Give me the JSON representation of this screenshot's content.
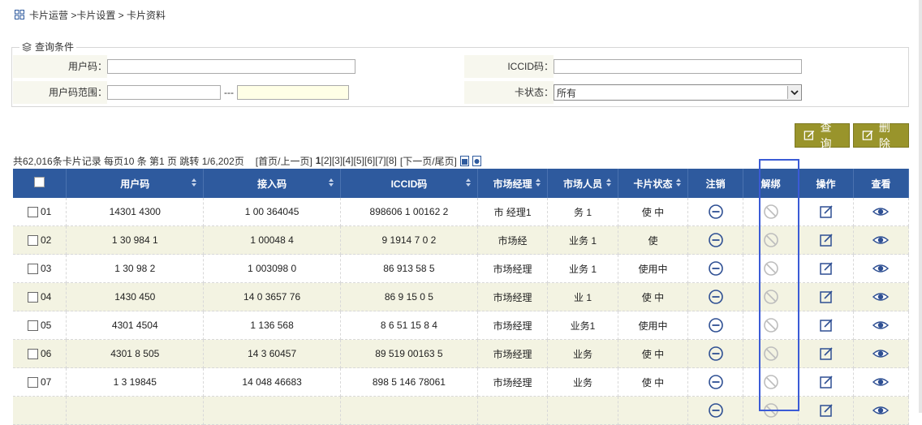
{
  "breadcrumb": {
    "text": "卡片运营 >卡片设置 > 卡片资料",
    "icon": "grid-icon"
  },
  "query": {
    "legend": "查询条件",
    "legend_icon": "layers-icon",
    "user_code_label": "用户码：",
    "user_code_value": "",
    "iccid_label": "ICCID码：",
    "iccid_value": "",
    "range_label": "用户码范围：",
    "range_from": "",
    "range_separator": "---",
    "range_to": "",
    "status_label": "卡状态：",
    "status_value": "所有"
  },
  "buttons": {
    "search": "查询",
    "delete": "删除"
  },
  "pager": {
    "summary": "共62,016条卡片记录 每页10 条 第1 页 跳转 1/6,202页",
    "first_prev": "[首页/上一页]",
    "current": "1",
    "pages": [
      "[2]",
      "[3]",
      "[4]",
      "[5]",
      "[6]",
      "[7]",
      "[8]"
    ],
    "next_last": "[下一页/尾页]"
  },
  "table": {
    "headers": [
      "",
      "用户码",
      "接入码",
      "ICCID码",
      "市场经理",
      "市场人员",
      "卡片状态",
      "注销",
      "解绑",
      "操作",
      "查看"
    ],
    "rows": [
      {
        "no": "01",
        "user": "14301 4300",
        "access": "1 00 364045",
        "iccid": "898606 1  00162 2",
        "mgr": "市 经理1",
        "staff": "务 1",
        "status": "使 中"
      },
      {
        "no": "02",
        "user": "1 30 984 1",
        "access": "1 00048 4",
        "iccid": "9 1914  7 0 2",
        "mgr": "市场经",
        "staff": "业务 1",
        "status": "使"
      },
      {
        "no": "03",
        "user": "1 30 98 2",
        "access": "1 003098 0",
        "iccid": "86 913 58 5",
        "mgr": "市场经理",
        "staff": "业务 1",
        "status": "使用中"
      },
      {
        "no": "04",
        "user": "1430 450",
        "access": "14 0 3657 76",
        "iccid": "86 9 15 0 5",
        "mgr": "市场经理",
        "staff": "业 1",
        "status": "使 中"
      },
      {
        "no": "05",
        "user": "4301 4504",
        "access": "1  136 568",
        "iccid": "8 6 51 15 8 4",
        "mgr": "市场经理",
        "staff": "业务1",
        "status": "使用中"
      },
      {
        "no": "06",
        "user": "4301 8 505",
        "access": "14 3 60457",
        "iccid": "89 519 00163 5",
        "mgr": "市场经理",
        "staff": "业务",
        "status": "使 中"
      },
      {
        "no": "07",
        "user": "1 3 19845",
        "access": "14 048 46683",
        "iccid": "898 5 146 78061",
        "mgr": "市场经理",
        "staff": "业务",
        "status": "使 中"
      },
      {
        "no": "",
        "user": "",
        "access": "",
        "iccid": "",
        "mgr": "",
        "staff": "",
        "status": ""
      }
    ]
  },
  "colors": {
    "header_bg": "#2e5a9e",
    "button_bg": "#99942b",
    "row_alt": "#f3f3e2",
    "highlight": "#3b5bd6"
  }
}
